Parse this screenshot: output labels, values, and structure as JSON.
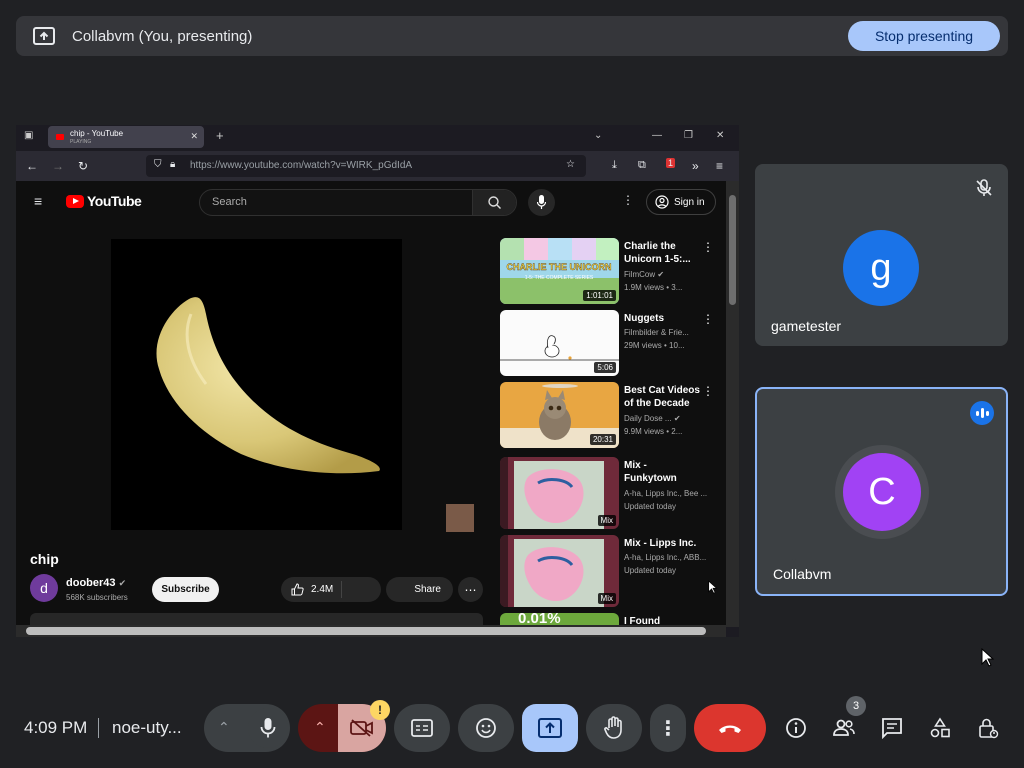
{
  "banner": {
    "title": "Collabvm (You, presenting)",
    "stop_label": "Stop presenting"
  },
  "browser": {
    "tab_title": "chip - YouTube",
    "tab_subtitle": "PLAYING",
    "url": "https://www.youtube.com/watch?v=WIRK_pGdIdA",
    "notification_count": "1"
  },
  "youtube": {
    "logo_text": "YouTube",
    "search_placeholder": "Search",
    "signin_label": "Sign in",
    "video_title": "chip",
    "channel_initial": "d",
    "channel_name": "doober43",
    "subscribers": "568K subscribers",
    "subscribe_label": "Subscribe",
    "likes": "2.4M",
    "share_label": "Share",
    "recommendations": [
      {
        "title": "Charlie the Unicorn 1-5:...",
        "channel": "FilmCow",
        "views": "1.9M views",
        "age": "3...",
        "duration": "1:01:01",
        "thumb_text": "CHARLIE THE UNICORN",
        "thumb_sub": "1-5: THE COMPLETE SERIES"
      },
      {
        "title": "Nuggets",
        "channel": "Filmbilder & Frie...",
        "views": "29M views",
        "age": "10...",
        "duration": "5:06"
      },
      {
        "title": "Best Cat Videos of the Decade",
        "channel": "Daily Dose ...",
        "views": "9.9M views",
        "age": "2...",
        "duration": "20:31"
      },
      {
        "title": "Mix - Funkytown",
        "channel": "A-ha, Lipps Inc., Bee ...",
        "views": "Updated today",
        "duration": "Mix"
      },
      {
        "title": "Mix - Lipps Inc.",
        "channel": "A-ha, Lipps Inc., ABB...",
        "views": "Updated today",
        "duration": "Mix"
      },
      {
        "title": "I Found",
        "thumb_text": "0.01%"
      }
    ]
  },
  "participants": [
    {
      "name": "gametester",
      "initial": "g",
      "color": "#1a73e8",
      "muted": true
    },
    {
      "name": "Collabvm",
      "initial": "C",
      "color": "#a142f4",
      "speaking": true
    }
  ],
  "toolbar": {
    "time": "4:09 PM",
    "meeting_code": "noe-uty...",
    "participant_count": "3",
    "camera_warning": "!"
  }
}
